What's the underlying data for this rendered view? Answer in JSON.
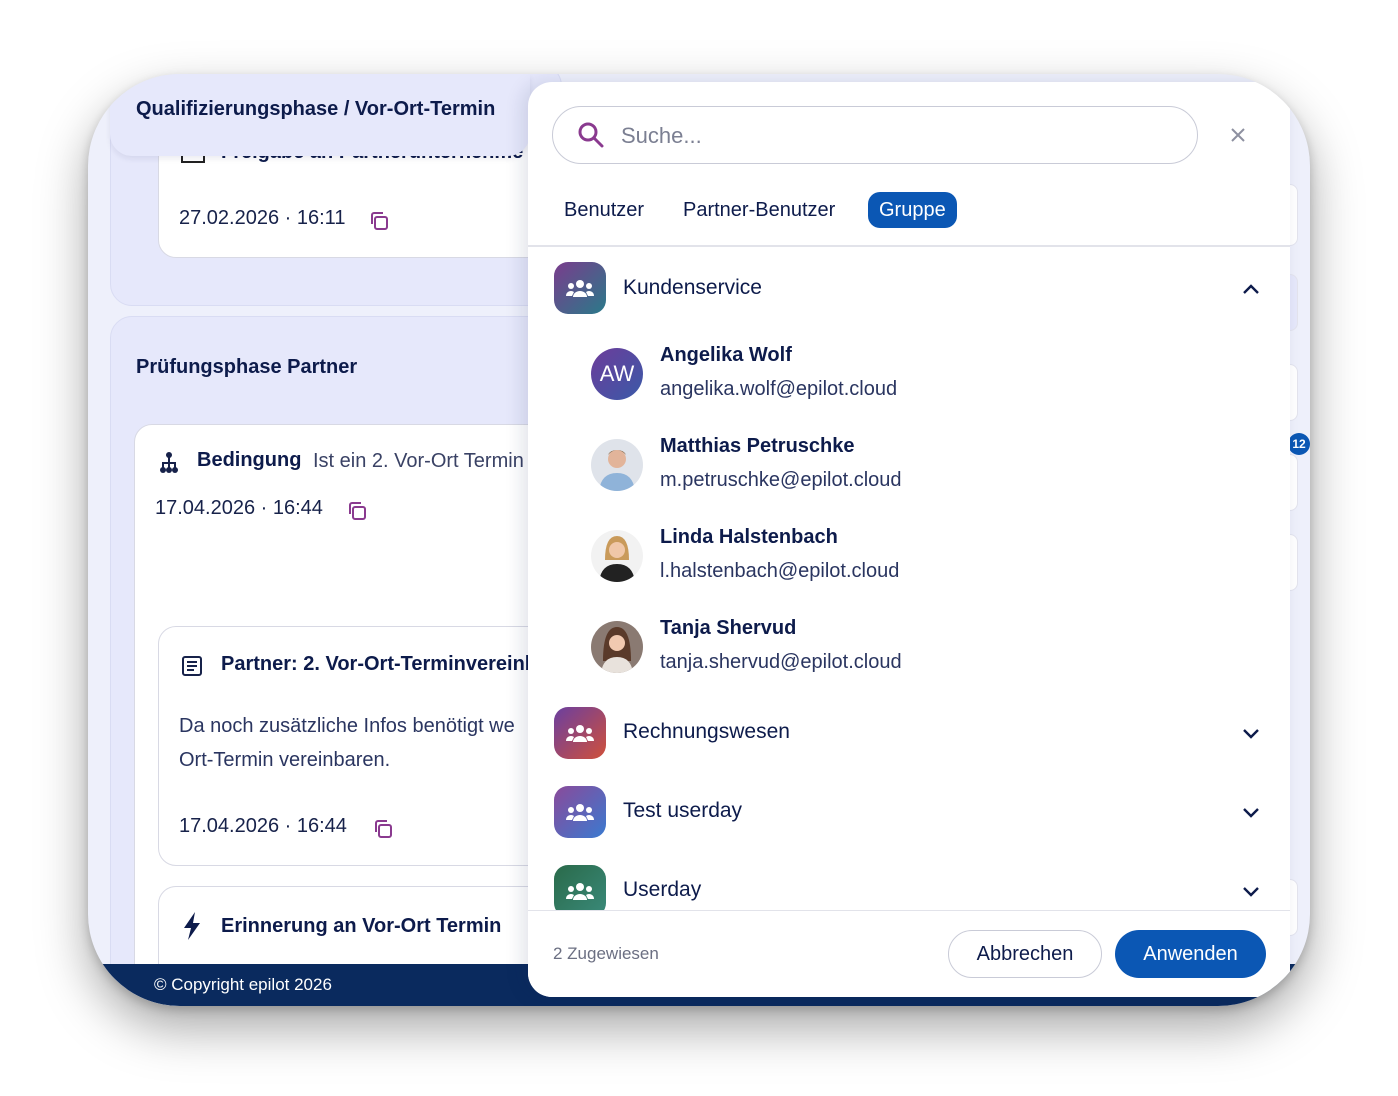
{
  "phases": [
    {
      "title": "Qualifizierungsphase / Vor-Ort-Termin",
      "cards": [
        {
          "title_cut": "Freigabe an Partnerunternehme",
          "timestamp": "27.02.2026 · 16:11"
        }
      ]
    },
    {
      "title": "Prüfungsphase Partner",
      "condition": {
        "label": "Bedingung",
        "text": "Ist ein 2. Vor-Ort Termin",
        "timestamp": "17.04.2026 · 16:44"
      },
      "task": {
        "title": "Partner: 2. Vor-Ort-Terminvereinb",
        "body_line1": "Da noch zusätzliche Infos benötigt we",
        "body_line2": "Ort-Termin vereinbaren.",
        "timestamp": "17.04.2026 · 16:44"
      },
      "automation": {
        "title": "Erinnerung an Vor-Ort Termin"
      }
    }
  ],
  "side_badge": "12",
  "footer": {
    "copyright": "© Copyright epilot 2026"
  },
  "popup": {
    "search_placeholder": "Suche...",
    "tabs": [
      "Benutzer",
      "Partner-Benutzer",
      "Gruppe"
    ],
    "active_tab": "Gruppe",
    "groups": [
      {
        "name": "Kundenservice",
        "expanded": true,
        "members": [
          {
            "initials": "AW",
            "name": "Angelika Wolf",
            "email": "angelika.wolf@epilot.cloud"
          },
          {
            "initials": "",
            "name": "Matthias Petruschke",
            "email": "m.petruschke@epilot.cloud"
          },
          {
            "initials": "",
            "name": "Linda Halstenbach",
            "email": "l.halstenbach@epilot.cloud"
          },
          {
            "initials": "",
            "name": "Tanja Shervud",
            "email": "tanja.shervud@epilot.cloud"
          }
        ]
      },
      {
        "name": "Rechnungswesen",
        "expanded": false
      },
      {
        "name": "Test userday",
        "expanded": false
      },
      {
        "name": "Userday",
        "expanded": false
      }
    ],
    "assigned_count": "2 Zugewiesen",
    "cancel_label": "Abbrechen",
    "apply_label": "Anwenden"
  },
  "colors": {
    "primary": "#0b57b4",
    "navy_text": "#0d1b4b",
    "footer_bg": "#0a2a5e",
    "accent_purple": "#8a3a8f"
  }
}
